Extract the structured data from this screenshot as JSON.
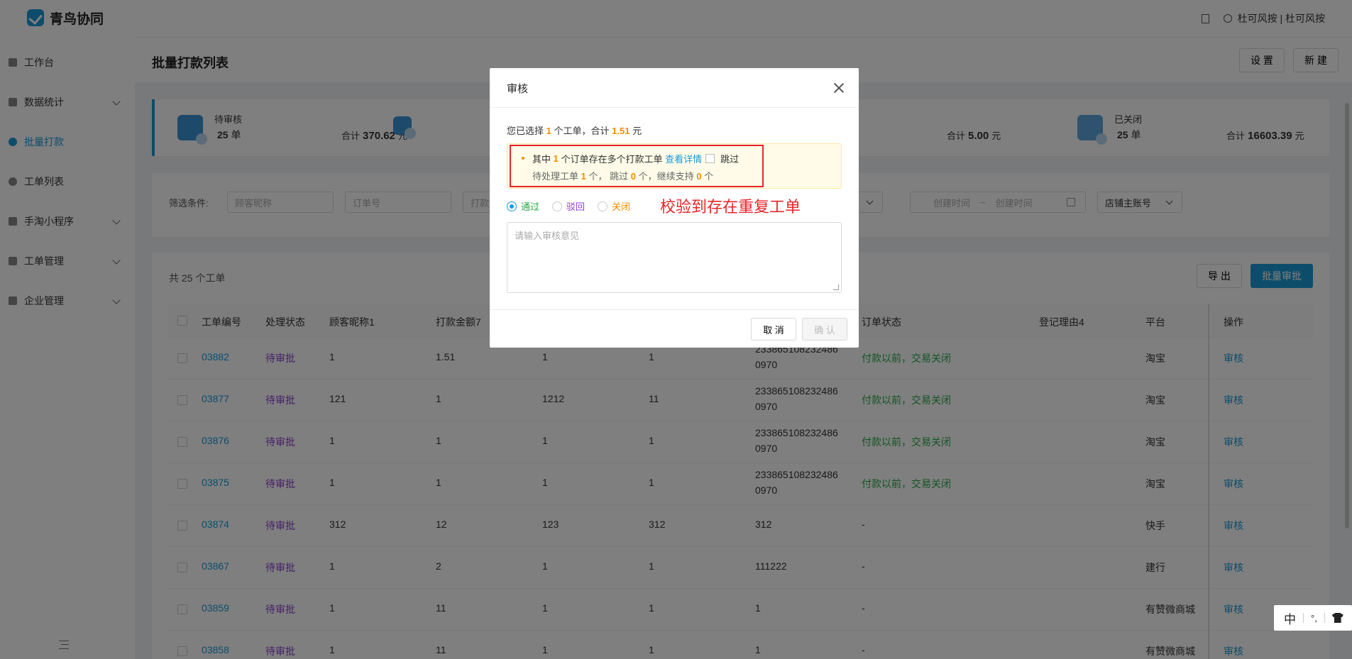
{
  "app": {
    "name": "青鸟协同"
  },
  "sidebar": {
    "items": [
      {
        "label": "工作台",
        "has_children": false,
        "active": false
      },
      {
        "label": "数据统计",
        "has_children": true,
        "active": false
      },
      {
        "label": "批量打款",
        "has_children": false,
        "active": true
      },
      {
        "label": "工单列表",
        "has_children": false,
        "active": false
      },
      {
        "label": "手淘小程序",
        "has_children": true,
        "active": false
      },
      {
        "label": "工单管理",
        "has_children": true,
        "active": false
      },
      {
        "label": "企业管理",
        "has_children": true,
        "active": false
      }
    ]
  },
  "header": {
    "user": "杜可风按 | 杜可风按"
  },
  "page": {
    "title": "批量打款列表",
    "settings_label": "设 置",
    "new_label": "新 建"
  },
  "stats": {
    "pending": {
      "label": "待审核",
      "count": "25",
      "unit": "单",
      "total_label": "合计",
      "total": "370.62",
      "currency": "元"
    },
    "middle": {
      "total_label": "合计",
      "total": "5.00",
      "currency": "元"
    },
    "closed": {
      "label": "已关闭",
      "count": "25",
      "unit": "单",
      "total_label": "合计",
      "total": "16603.39",
      "currency": "元"
    }
  },
  "filters": {
    "label": "筛选条件:",
    "customer_placeholder": "顾客昵称",
    "order_placeholder": "订单号",
    "amount_placeholder": "打款",
    "date_start": "创建时间",
    "date_sep": "~",
    "date_end": "创建时间",
    "shop_select": "店铺主账号"
  },
  "table": {
    "count_text": "共 25 个工单",
    "export_label": "导 出",
    "batch_label": "批量审批",
    "headers": [
      "工单编号",
      "处理状态",
      "顾客昵称1",
      "打款金额7",
      "订单状态",
      "登记理由4",
      "平台",
      "操作"
    ],
    "rows": [
      {
        "id": "03882",
        "status": "待审批",
        "nick": "1",
        "amount": "1.51",
        "c5": "1",
        "c6": "1",
        "order_no": "233865108232486",
        "order_no2": "0970",
        "order_status": "付款以前，交易关闭",
        "platform": "淘宝",
        "op": "审核"
      },
      {
        "id": "03877",
        "status": "待审批",
        "nick": "121",
        "amount": "1",
        "c5": "1212",
        "c6": "11",
        "order_no": "233865108232486",
        "order_no2": "0970",
        "order_status": "付款以前，交易关闭",
        "platform": "淘宝",
        "op": "审核"
      },
      {
        "id": "03876",
        "status": "待审批",
        "nick": "1",
        "amount": "1",
        "c5": "1",
        "c6": "1",
        "order_no": "233865108232486",
        "order_no2": "0970",
        "order_status": "付款以前，交易关闭",
        "platform": "淘宝",
        "op": "审核"
      },
      {
        "id": "03875",
        "status": "待审批",
        "nick": "1",
        "amount": "1",
        "c5": "1",
        "c6": "1",
        "order_no": "233865108232486",
        "order_no2": "0970",
        "order_status": "付款以前，交易关闭",
        "platform": "淘宝",
        "op": "审核"
      },
      {
        "id": "03874",
        "status": "待审批",
        "nick": "312",
        "amount": "12",
        "c5": "123",
        "c6": "312",
        "order_no": "312",
        "order_no2": "",
        "order_status": "-",
        "platform": "快手",
        "op": "审核"
      },
      {
        "id": "03867",
        "status": "待审批",
        "nick": "1",
        "amount": "2",
        "c5": "1",
        "c6": "1",
        "order_no": "111222",
        "order_no2": "",
        "order_status": "-",
        "platform": "建行",
        "op": "审核"
      },
      {
        "id": "03859",
        "status": "待审批",
        "nick": "1",
        "amount": "11",
        "c5": "1",
        "c6": "1",
        "order_no": "1",
        "order_no2": "",
        "order_status": "-",
        "platform": "有赞微商城",
        "op": "审核"
      },
      {
        "id": "03858",
        "status": "待审批",
        "nick": "1",
        "amount": "11",
        "c5": "1",
        "c6": "1",
        "order_no": "1",
        "order_no2": "",
        "order_status": "-",
        "platform": "有赞微商城",
        "op": "审核"
      }
    ]
  },
  "modal": {
    "title": "审核",
    "summary_pre": "您已选择",
    "summary_count": "1",
    "summary_mid": "个工单，合计",
    "summary_total": "1.51",
    "summary_unit": "元",
    "warn_pre": "其中",
    "warn_count": "1",
    "warn_mid": "个订单存在多个打款工单",
    "warn_link": "查看详情",
    "warn_skip": "跳过",
    "line2_a": "待处理工单",
    "line2_n1": "1",
    "line2_b": "个，  跳过",
    "line2_n2": "0",
    "line2_c": "个，继续支持",
    "line2_n3": "0",
    "line2_d": "个",
    "radio_pass": "通过",
    "radio_reject": "驳回",
    "radio_close": "关闭",
    "annotation": "校验到存在重复工单",
    "opinion_placeholder": "请输入审核意见",
    "cancel_label": "取 消",
    "confirm_label": "确 认"
  },
  "ime": {
    "mode": "中",
    "punct": "°,",
    "skin": "shirt-icon"
  },
  "colors": {
    "accent": "#1a9bd7",
    "warning": "#f08c00",
    "annotation": "#e8262b",
    "status_pending": "#8a3fd1",
    "status_closed": "#2aa84a"
  }
}
